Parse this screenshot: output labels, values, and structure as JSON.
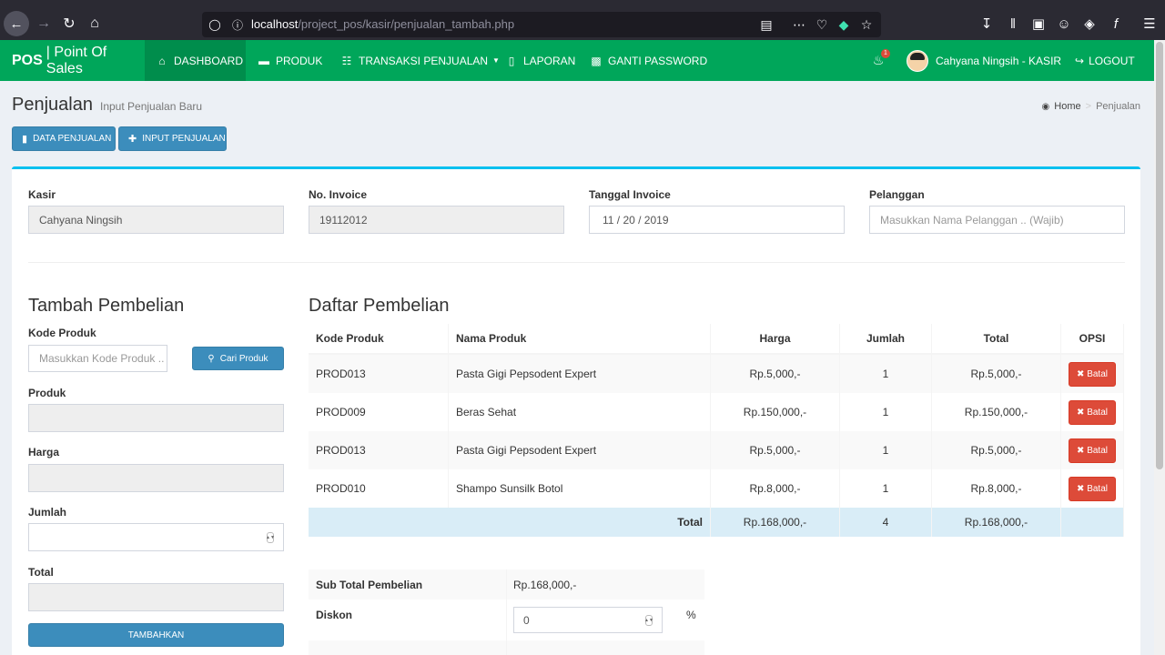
{
  "browser": {
    "url_host": "localhost",
    "url_path": "/project_pos/kasir/penjualan_tambah.php"
  },
  "navbar": {
    "brand_bold": "POS",
    "brand_rest": "| Point Of Sales",
    "menu": [
      {
        "label": "DASHBOARD",
        "icon": "home-icon"
      },
      {
        "label": "PRODUK",
        "icon": "folder-icon"
      },
      {
        "label": "TRANSAKSI PENJUALAN",
        "icon": "cart-icon"
      },
      {
        "label": "LAPORAN",
        "icon": "file-icon"
      },
      {
        "label": "GANTI PASSWORD",
        "icon": "lock-icon"
      }
    ],
    "notif_count": "1",
    "user": "Cahyana Ningsih - KASIR",
    "logout": "LOGOUT"
  },
  "header": {
    "title": "Penjualan",
    "subtitle": "Input Penjualan Baru",
    "breadcrumb_home": "Home",
    "breadcrumb_current": "Penjualan",
    "btn_data": "DATA PENJUALAN",
    "btn_input": "INPUT PENJUALAN"
  },
  "form_top": {
    "kasir_label": "Kasir",
    "kasir_value": "Cahyana Ningsih",
    "invoice_label": "No. Invoice",
    "invoice_value": "19112012",
    "tanggal_label": "Tanggal Invoice",
    "tanggal_value": "11 / 20 / 2019",
    "pelanggan_label": "Pelanggan",
    "pelanggan_placeholder": "Masukkan Nama Pelanggan .. (Wajib)"
  },
  "tambah": {
    "title": "Tambah Pembelian",
    "kode_label": "Kode Produk",
    "kode_placeholder": "Masukkan Kode Produk ..",
    "cari_button": "Cari Produk",
    "produk_label": "Produk",
    "harga_label": "Harga",
    "jumlah_label": "Jumlah",
    "total_label": "Total",
    "tambahkan_button": "TAMBAHKAN"
  },
  "daftar": {
    "title": "Daftar Pembelian",
    "columns": [
      "Kode Produk",
      "Nama Produk",
      "Harga",
      "Jumlah",
      "Total",
      "OPSI"
    ],
    "rows": [
      {
        "kode": "PROD013",
        "nama": "Pasta Gigi Pepsodent Expert",
        "harga": "Rp.5,000,-",
        "jumlah": "1",
        "total": "Rp.5,000,-",
        "aksi": "Batal"
      },
      {
        "kode": "PROD009",
        "nama": "Beras Sehat",
        "harga": "Rp.150,000,-",
        "jumlah": "1",
        "total": "Rp.150,000,-",
        "aksi": "Batal"
      },
      {
        "kode": "PROD013",
        "nama": "Pasta Gigi Pepsodent Expert",
        "harga": "Rp.5,000,-",
        "jumlah": "1",
        "total": "Rp.5,000,-",
        "aksi": "Batal"
      },
      {
        "kode": "PROD010",
        "nama": "Shampo Sunsilk Botol",
        "harga": "Rp.8,000,-",
        "jumlah": "1",
        "total": "Rp.8,000,-",
        "aksi": "Batal"
      }
    ],
    "footer": {
      "label": "Total",
      "harga": "Rp.168,000,-",
      "jumlah": "4",
      "total": "Rp.168,000,-"
    }
  },
  "summary": {
    "subtotal_label": "Sub Total Pembelian",
    "subtotal_value": "Rp.168,000,-",
    "diskon_label": "Diskon",
    "diskon_value": "0",
    "diskon_unit": "%"
  }
}
